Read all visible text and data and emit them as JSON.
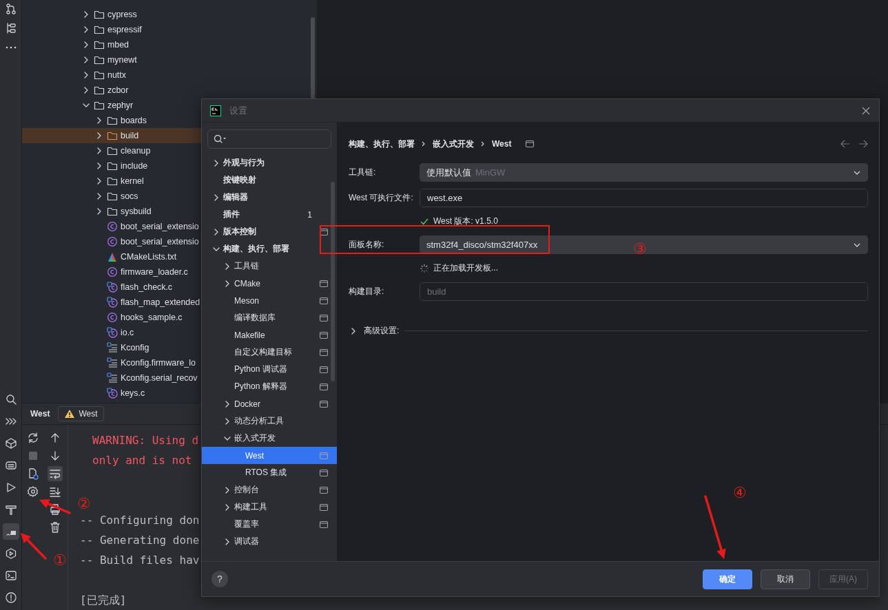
{
  "tool_stripe": [
    {
      "selected": false
    },
    {
      "selected": false
    },
    {
      "selected": false
    },
    {
      "selected": false
    },
    {
      "selected": false
    },
    {
      "selected": false
    },
    {
      "selected": true
    },
    {
      "selected": false
    },
    {
      "selected": false
    },
    {
      "selected": false
    }
  ],
  "project_tree": [
    {
      "kind": "folder",
      "label": "cypress",
      "expanded": false,
      "selected": false
    },
    {
      "kind": "folder",
      "label": "espressif",
      "expanded": false,
      "selected": false
    },
    {
      "kind": "folder",
      "label": "mbed",
      "expanded": false,
      "selected": false
    },
    {
      "kind": "folder",
      "label": "mynewt",
      "expanded": false,
      "selected": false
    },
    {
      "kind": "folder",
      "label": "nuttx",
      "expanded": false,
      "selected": false
    },
    {
      "kind": "folder",
      "label": "zcbor",
      "expanded": false,
      "selected": false
    },
    {
      "kind": "folder",
      "label": "zephyr",
      "expanded": true,
      "selected": false,
      "children": [
        {
          "kind": "folder",
          "label": "boards",
          "expanded": false,
          "selected": false
        },
        {
          "kind": "folder",
          "label": "build",
          "expanded": false,
          "selected": true
        },
        {
          "kind": "folder",
          "label": "cleanup",
          "expanded": false,
          "selected": false
        },
        {
          "kind": "folder",
          "label": "include",
          "expanded": false,
          "selected": false
        },
        {
          "kind": "folder",
          "label": "kernel",
          "expanded": false,
          "selected": false
        },
        {
          "kind": "folder",
          "label": "socs",
          "expanded": false,
          "selected": false
        },
        {
          "kind": "folder",
          "label": "sysbuild",
          "expanded": false,
          "selected": false
        },
        {
          "kind": "c",
          "label": "boot_serial_extensio",
          "selected": false
        },
        {
          "kind": "c",
          "label": "boot_serial_extensio",
          "selected": false
        },
        {
          "kind": "cmake",
          "label": "CMakeLists.txt",
          "selected": false
        },
        {
          "kind": "c",
          "label": "firmware_loader.c",
          "selected": false
        },
        {
          "kind": "c_linked",
          "label": "flash_check.c",
          "selected": false
        },
        {
          "kind": "c_linked",
          "label": "flash_map_extended",
          "selected": false
        },
        {
          "kind": "c",
          "label": "hooks_sample.c",
          "selected": false
        },
        {
          "kind": "c_linked",
          "label": "io.c",
          "selected": false
        },
        {
          "kind": "kconfig",
          "label": "Kconfig",
          "selected": false
        },
        {
          "kind": "kconfig",
          "label": "Kconfig.firmware_lo",
          "selected": false
        },
        {
          "kind": "kconfig",
          "label": "Kconfig.serial_recov",
          "selected": false
        },
        {
          "kind": "c_linked",
          "label": "keys.c",
          "selected": false
        }
      ]
    }
  ],
  "tool_window": {
    "title": "West",
    "tabs": [
      {
        "label": "West",
        "warning": true,
        "selected": true
      }
    ],
    "soft_wrap": {
      "on": true
    },
    "console": [
      {
        "kind": "warning",
        "text": "WARNING: Using d"
      },
      {
        "kind": "warning",
        "text": "only and is not"
      },
      {
        "kind": "blank"
      },
      {
        "kind": "blank"
      },
      {
        "kind": "info",
        "text": "-- Configuring don"
      },
      {
        "kind": "info",
        "text": "-- Generating done"
      },
      {
        "kind": "info",
        "text": "-- Build files hav"
      },
      {
        "kind": "blank"
      },
      {
        "kind": "info",
        "text": "[已完成]"
      }
    ]
  },
  "dialog": {
    "title": "设置",
    "nav": [
      {
        "kind": "group",
        "label": "外观与行为",
        "expanded": false,
        "selected": false
      },
      {
        "kind": "page",
        "label": "按键映射",
        "selected": false
      },
      {
        "kind": "group",
        "label": "编辑器",
        "expanded": false,
        "selected": false
      },
      {
        "kind": "page",
        "label": "插件",
        "badge": "1",
        "selected": false
      },
      {
        "kind": "group",
        "label": "版本控制",
        "expanded": false,
        "project_icon": true,
        "selected": false
      },
      {
        "kind": "group",
        "label": "构建、执行、部署",
        "expanded": true,
        "selected": false,
        "children": [
          {
            "kind": "group",
            "label": "工具链",
            "expanded": false,
            "selected": false
          },
          {
            "kind": "group",
            "label": "CMake",
            "expanded": false,
            "project_icon": true,
            "selected": false
          },
          {
            "kind": "page",
            "label": "Meson",
            "project_icon": true,
            "selected": false
          },
          {
            "kind": "page",
            "label": "编译数据库",
            "project_icon": true,
            "selected": false
          },
          {
            "kind": "page",
            "label": "Makefile",
            "project_icon": true,
            "selected": false
          },
          {
            "kind": "page",
            "label": "自定义构建目标",
            "project_icon": true,
            "selected": false
          },
          {
            "kind": "page",
            "label": "Python 调试器",
            "project_icon": true,
            "selected": false
          },
          {
            "kind": "page",
            "label": "Python 解释器",
            "project_icon": true,
            "selected": false
          },
          {
            "kind": "group",
            "label": "Docker",
            "expanded": false,
            "project_icon": true,
            "selected": false
          },
          {
            "kind": "group",
            "label": "动态分析工具",
            "expanded": false,
            "selected": false
          },
          {
            "kind": "group",
            "label": "嵌入式开发",
            "expanded": true,
            "selected": false,
            "children": [
              {
                "kind": "page",
                "label": "West",
                "project_icon": true,
                "selected": true
              },
              {
                "kind": "page",
                "label": "RTOS 集成",
                "project_icon": true,
                "selected": false
              }
            ]
          },
          {
            "kind": "group",
            "label": "控制台",
            "expanded": false,
            "project_icon": true,
            "selected": false
          },
          {
            "kind": "group",
            "label": "构建工具",
            "expanded": false,
            "project_icon": true,
            "selected": false
          },
          {
            "kind": "page",
            "label": "覆盖率",
            "project_icon": true,
            "selected": false
          },
          {
            "kind": "group",
            "label": "调试器",
            "expanded": false,
            "selected": false
          }
        ]
      }
    ],
    "breadcrumb": [
      "构建、执行、部署",
      "嵌入式开发",
      "West"
    ],
    "form": [
      {
        "kind": "dropdown",
        "label": "工具链:",
        "value": "使用默认值",
        "hint": "MinGW"
      },
      {
        "kind": "text",
        "label": "West 可执行文件:",
        "value": "west.exe"
      },
      {
        "kind": "status",
        "loading": false,
        "text": "West 版本: v1.5.0"
      },
      {
        "kind": "dropdown",
        "label": "面板名称:",
        "value": "stm32f4_disco/stm32f407xx",
        "highlighted": true
      },
      {
        "kind": "status",
        "loading": true,
        "text": "正在加载开发板..."
      },
      {
        "kind": "text",
        "label": "构建目录:",
        "placeholder": "build"
      }
    ],
    "advanced": {
      "label": "高级设置:",
      "expanded": false
    },
    "help": "?",
    "buttons": [
      {
        "label": "确定",
        "kind": "primary",
        "disabled": false
      },
      {
        "label": "取消",
        "kind": "secondary",
        "disabled": false
      },
      {
        "label": "应用(A)",
        "kind": "secondary",
        "disabled": true
      }
    ]
  },
  "annotations": [
    "①",
    "②",
    "③",
    "④"
  ]
}
